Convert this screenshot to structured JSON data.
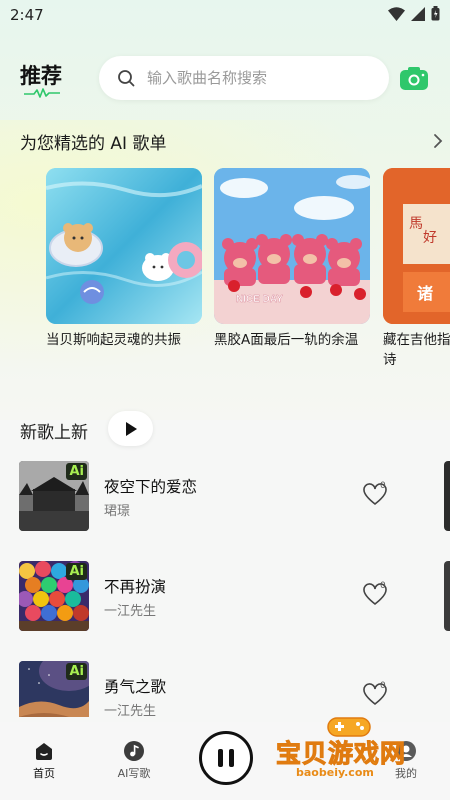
{
  "status_bar": {
    "time": "2:47"
  },
  "header": {
    "title": "推荐",
    "search_placeholder": "输入歌曲名称搜索"
  },
  "playlists": {
    "section_title": "为您精选的 AI 歌单",
    "items": [
      {
        "caption": "当贝斯响起灵魂的共振"
      },
      {
        "caption": "黑胶A面最后一轨的余温",
        "cover_text": "NICE DAY"
      },
      {
        "caption": "藏在吉他指\n诗",
        "cover_text": "诸"
      }
    ]
  },
  "new_songs": {
    "section_title": "新歌上新",
    "badge": "Ai",
    "items": [
      {
        "title": "夜空下的爱恋",
        "artist": "珺璟",
        "likes": "0"
      },
      {
        "title": "不再扮演",
        "artist": "一江先生",
        "likes": "0"
      },
      {
        "title": "勇气之歌",
        "artist": "一江先生",
        "likes": "0"
      }
    ]
  },
  "bottom_nav": {
    "tabs": [
      {
        "label": "首页",
        "icon": "home-icon"
      },
      {
        "label": "AI写歌",
        "icon": "music-note-icon"
      },
      {
        "label": "我的",
        "icon": "profile-icon"
      }
    ]
  },
  "watermark": {
    "text": "宝贝游戏网",
    "url": "baobeiy.com"
  },
  "colors": {
    "accent": "#2fc76b",
    "badge_green": "#a7f051",
    "watermark": "#f6a724"
  }
}
